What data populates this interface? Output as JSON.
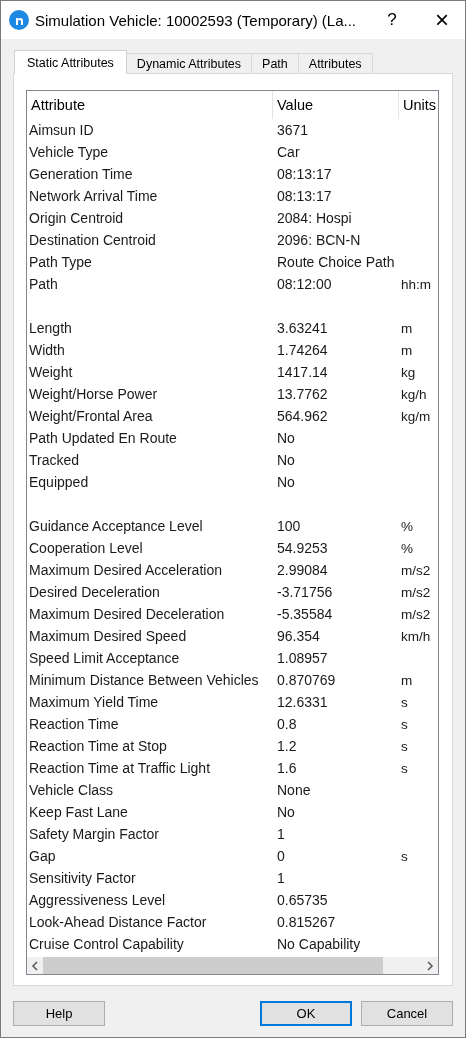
{
  "window": {
    "title": "Simulation Vehicle: 10002593 (Temporary) (La...",
    "help": "?",
    "close": "×"
  },
  "tabs": [
    {
      "label": "Static Attributes",
      "selected": true
    },
    {
      "label": "Dynamic Attributes",
      "selected": false
    },
    {
      "label": "Path",
      "selected": false
    },
    {
      "label": "Attributes",
      "selected": false
    }
  ],
  "table": {
    "columns": [
      "Attribute",
      "Value",
      "Units"
    ],
    "rows": [
      {
        "kind": "data",
        "attribute": "Aimsun ID",
        "value": "3671"
      },
      {
        "kind": "data",
        "attribute": "Vehicle Type",
        "value": "Car"
      },
      {
        "kind": "data",
        "attribute": "Generation Time",
        "value": "08:13:17"
      },
      {
        "kind": "data",
        "attribute": "Network Arrival Time",
        "value": "08:13:17"
      },
      {
        "kind": "data",
        "attribute": "Origin Centroid",
        "value": "2084: Hospi"
      },
      {
        "kind": "data",
        "attribute": "Destination Centroid",
        "value": "2096: BCN-N"
      },
      {
        "kind": "data",
        "attribute": "Path Type",
        "value": "Route Choice Path"
      },
      {
        "kind": "data",
        "attribute": "Path",
        "value": "08:12:00",
        "units": "hh:m"
      },
      {
        "kind": "blank"
      },
      {
        "kind": "data",
        "attribute": "Length",
        "value": "3.63241",
        "units": "m"
      },
      {
        "kind": "data",
        "attribute": "Width",
        "value": "1.74264",
        "units": "m"
      },
      {
        "kind": "data",
        "attribute": "Weight",
        "value": "1417.14",
        "units": "kg"
      },
      {
        "kind": "data",
        "attribute": "Weight/Horse Power",
        "value": "13.7762",
        "units": "kg/h"
      },
      {
        "kind": "data",
        "attribute": "Weight/Frontal Area",
        "value": "564.962",
        "units": "kg/m"
      },
      {
        "kind": "data",
        "attribute": "Path Updated En Route",
        "value": "No"
      },
      {
        "kind": "data",
        "attribute": "Tracked",
        "value": "No"
      },
      {
        "kind": "data",
        "attribute": "Equipped",
        "value": "No"
      },
      {
        "kind": "blank"
      },
      {
        "kind": "data",
        "attribute": "Guidance Acceptance Level",
        "value": "100",
        "units": "%"
      },
      {
        "kind": "data",
        "attribute": "Cooperation Level",
        "value": "54.9253",
        "units": "%"
      },
      {
        "kind": "data",
        "attribute": "Maximum Desired Acceleration",
        "value": "2.99084",
        "units": "m/s2"
      },
      {
        "kind": "data",
        "attribute": "Desired Deceleration",
        "value": "-3.71756",
        "units": "m/s2"
      },
      {
        "kind": "data",
        "attribute": "Maximum Desired Deceleration",
        "value": "-5.35584",
        "units": "m/s2"
      },
      {
        "kind": "data",
        "attribute": "Maximum Desired Speed",
        "value": "96.354",
        "units": "km/h"
      },
      {
        "kind": "data",
        "attribute": "Speed Limit Acceptance",
        "value": "1.08957"
      },
      {
        "kind": "data",
        "attribute": "Minimum Distance Between Vehicles",
        "value": "0.870769",
        "units": "m"
      },
      {
        "kind": "data",
        "attribute": "Maximum Yield Time",
        "value": "12.6331",
        "units": "s"
      },
      {
        "kind": "data",
        "attribute": "Reaction Time",
        "value": "0.8",
        "units": "s"
      },
      {
        "kind": "data",
        "attribute": "Reaction Time at Stop",
        "value": "1.2",
        "units": "s"
      },
      {
        "kind": "data",
        "attribute": "Reaction Time at Traffic Light",
        "value": "1.6",
        "units": "s"
      },
      {
        "kind": "data",
        "attribute": "Vehicle Class",
        "value": "None"
      },
      {
        "kind": "data",
        "attribute": "Keep Fast Lane",
        "value": "No"
      },
      {
        "kind": "data",
        "attribute": "Safety Margin Factor",
        "value": "1"
      },
      {
        "kind": "data",
        "attribute": "Gap",
        "value": "0",
        "units": "s"
      },
      {
        "kind": "data",
        "attribute": "Sensitivity Factor",
        "value": "1"
      },
      {
        "kind": "data",
        "attribute": "Aggressiveness Level",
        "value": "0.65735"
      },
      {
        "kind": "data",
        "attribute": "Look-Ahead Distance Factor",
        "value": "0.815267"
      },
      {
        "kind": "data",
        "attribute": "Cruise Control Capability",
        "value": "No Capability"
      }
    ]
  },
  "buttons": [
    {
      "label": "Help",
      "default": false
    },
    {
      "label": "OK",
      "default": true
    },
    {
      "label": "Cancel",
      "default": false
    }
  ]
}
